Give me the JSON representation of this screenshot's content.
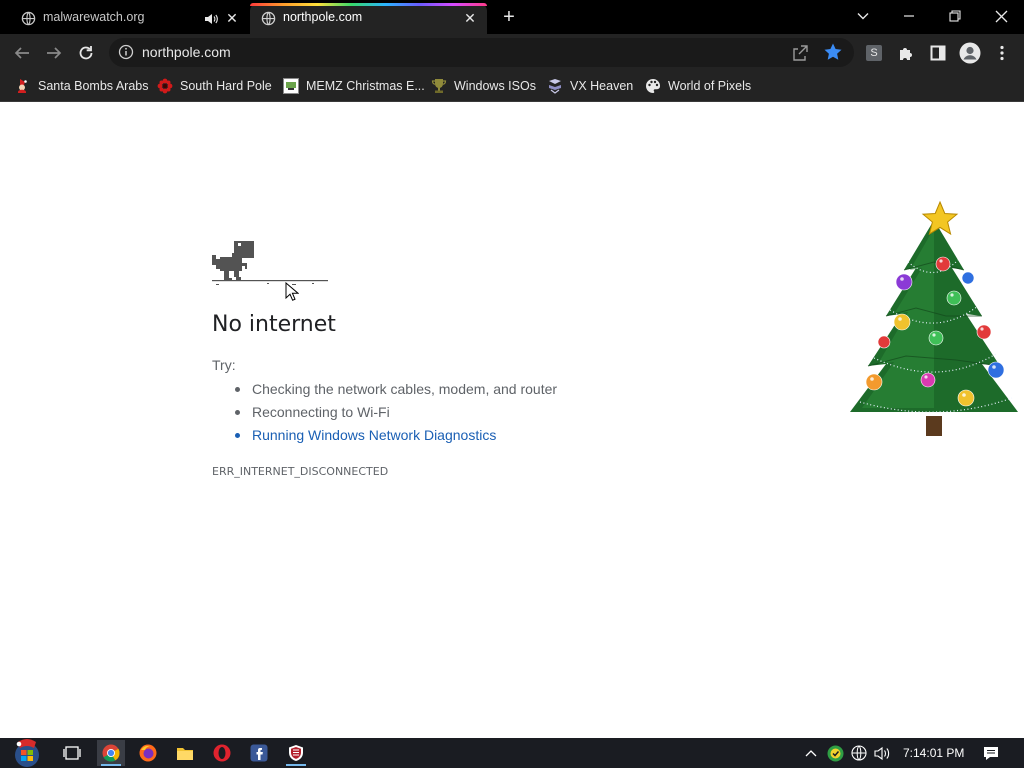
{
  "tabs": [
    {
      "title": "malwarewatch.org",
      "audio_icon": "speaker-icon",
      "active": false
    },
    {
      "title": "northpole.com",
      "active": true
    }
  ],
  "toolbar": {
    "url": "northpole.com",
    "profile_initial": "S"
  },
  "bookmarks": [
    {
      "label": "Santa Bombs Arabs",
      "icon": "santa-icon"
    },
    {
      "label": "South Hard Pole",
      "icon": "red-flower-icon"
    },
    {
      "label": "MEMZ Christmas E...",
      "icon": "memz-icon"
    },
    {
      "label": "Windows ISOs",
      "icon": "trophy-icon"
    },
    {
      "label": "VX Heaven",
      "icon": "vx-icon"
    },
    {
      "label": "World of Pixels",
      "icon": "palette-icon"
    }
  ],
  "error_page": {
    "title": "No internet",
    "try_label": "Try:",
    "suggestions": [
      "Checking the network cables, modem, and router",
      "Reconnecting to Wi-Fi",
      "Running Windows Network Diagnostics"
    ],
    "error_code": "ERR_INTERNET_DISCONNECTED"
  },
  "taskbar": {
    "clock": "7:14:01 PM"
  },
  "colors": {
    "accent_link": "#1a5fb4",
    "bookmark_star": "#3b8cf5",
    "chrome_dark": "#232323"
  }
}
